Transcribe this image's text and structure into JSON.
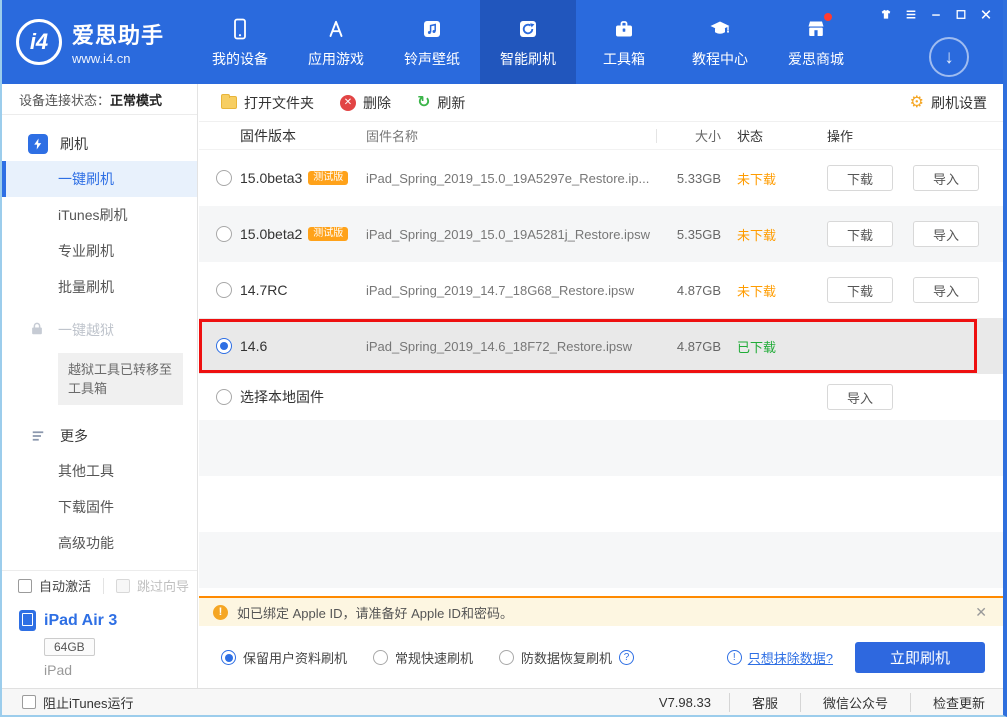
{
  "colors": {
    "brand_blue": "#2a6add",
    "accent_blue": "#2e6fe4",
    "warning_orange": "#ff9c00",
    "success_green": "#21ac38",
    "danger_red": "#ee1010"
  },
  "icons": {
    "close": "✕",
    "minimize": "—",
    "download_arrow": "↓",
    "gear": "⚙",
    "refresh": "↻",
    "delete_x": "✕",
    "warning": "!",
    "help": "?",
    "erase_info": "!"
  },
  "header": {
    "logo": {
      "mark": "i4",
      "brand": "爱思助手",
      "site": "www.i4.cn"
    },
    "nav_items": [
      {
        "label": "我的设备"
      },
      {
        "label": "应用游戏"
      },
      {
        "label": "铃声壁纸"
      },
      {
        "label": "智能刷机"
      },
      {
        "label": "工具箱"
      },
      {
        "label": "教程中心"
      },
      {
        "label": "爱思商城"
      }
    ]
  },
  "sidebar": {
    "status_label": "设备连接状态：",
    "status_value": "正常模式",
    "flash_title": "刷机",
    "flash_items": [
      "一键刷机",
      "iTunes刷机",
      "专业刷机",
      "批量刷机"
    ],
    "jailbreak_title": "一键越狱",
    "jailbreak_note_line1": "越狱工具已转移至",
    "jailbreak_note_line2": "工具箱",
    "more_title": "更多",
    "more_items": [
      "其他工具",
      "下载固件",
      "高级功能"
    ],
    "auto_activate_label": "自动激活",
    "skip_wizard_label": "跳过向导",
    "device": {
      "name": "iPad Air 3",
      "capacity": "64GB",
      "model": "iPad"
    }
  },
  "toolbar": {
    "open_folder": "打开文件夹",
    "delete": "删除",
    "refresh": "刷新",
    "settings": "刷机设置"
  },
  "table": {
    "header_labels": [
      "固件版本",
      "固件名称",
      "大小",
      "状态",
      "操作"
    ],
    "actions": {
      "download": "下载",
      "import": "导入"
    },
    "rows": [
      {
        "version": "15.0beta3",
        "badge": "测试版",
        "name": "iPad_Spring_2019_15.0_19A5297e_Restore.ip...",
        "size": "5.33GB",
        "status": "未下载"
      },
      {
        "version": "15.0beta2",
        "badge": "测试版",
        "name": "iPad_Spring_2019_15.0_19A5281j_Restore.ipsw",
        "size": "5.35GB",
        "status": "未下载"
      },
      {
        "version": "14.7RC",
        "name": "iPad_Spring_2019_14.7_18G68_Restore.ipsw",
        "size": "4.87GB",
        "status": "未下载"
      },
      {
        "version": "14.6",
        "name": "iPad_Spring_2019_14.6_18F72_Restore.ipsw",
        "size": "4.87GB",
        "status": "已下载"
      }
    ],
    "local_row": {
      "label": "选择本地固件"
    }
  },
  "notice": {
    "text": "如已绑定 Apple ID，请准备好 Apple ID和密码。"
  },
  "options": {
    "radios": [
      {
        "label": "保留用户资料刷机",
        "selected": true
      },
      {
        "label": "常规快速刷机",
        "selected": false
      },
      {
        "label": "防数据恢复刷机",
        "selected": false
      }
    ],
    "erase_link": "只想抹除数据?",
    "flash_button": "立即刷机"
  },
  "statusbar": {
    "block_itunes": "阻止iTunes运行",
    "version": "V7.98.33",
    "links": [
      "客服",
      "微信公众号",
      "检查更新"
    ]
  }
}
